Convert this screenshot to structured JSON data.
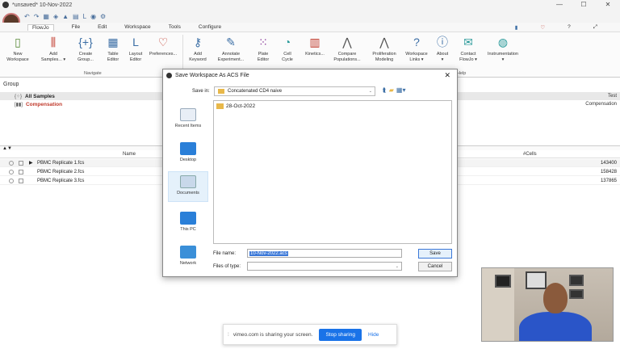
{
  "window": {
    "title": "*unsaved* 10-Nov-2022",
    "controls": [
      "—",
      "☐",
      "✕"
    ]
  },
  "tabs": [
    "FlowJo",
    "File",
    "Edit",
    "Workspace",
    "Tools",
    "Configure"
  ],
  "ribbon": {
    "buttons": [
      {
        "label": "New\nWorkspace",
        "icon": "new-doc-icon"
      },
      {
        "label": "Add\nSamples... ▾",
        "icon": "add-samples-icon"
      },
      {
        "label": "Create\nGroup...",
        "icon": "group-icon"
      },
      {
        "label": "Table\nEditor",
        "icon": "table-icon"
      },
      {
        "label": "Layout\nEditor",
        "icon": "layout-icon"
      },
      {
        "label": "Preferences...",
        "icon": "heart-icon"
      },
      {
        "label": "Add\nKeyword",
        "icon": "key-icon"
      },
      {
        "label": "Annotate\nExperiment...",
        "icon": "pen-icon"
      },
      {
        "label": "Plate\nEditor",
        "icon": "plate-icon"
      },
      {
        "label": "Cell\nCycle",
        "icon": "cell-cycle-icon"
      },
      {
        "label": "Kinetics...",
        "icon": "kinetics-icon"
      },
      {
        "label": "Compare\nPopulations...",
        "icon": "compare-icon"
      },
      {
        "label": "Proliferation\nModeling",
        "icon": "proliferation-icon"
      },
      {
        "label": "Workspace\nLinks ▾",
        "icon": "question-icon"
      },
      {
        "label": "About\n▾",
        "icon": "info-icon"
      },
      {
        "label": "Contact\nFlowJo ▾",
        "icon": "contact-icon"
      },
      {
        "label": "Instrumentation\n▾",
        "icon": "gauge-icon"
      }
    ],
    "group_navigate": "Navigate",
    "group_help": "Help"
  },
  "group_pane": {
    "header": "Group",
    "rows": [
      {
        "name": "All Samples",
        "right": "Test"
      },
      {
        "name": "Compensation",
        "right": "Compensation"
      }
    ]
  },
  "samples": {
    "col_name": "Name",
    "col_cells": "#Cells",
    "rows": [
      {
        "name": "PBMC Replicate 1.fcs",
        "cells": "143400"
      },
      {
        "name": "PBMC Replicate 2.fcs",
        "cells": "158428"
      },
      {
        "name": "PBMC Replicate 3.fcs",
        "cells": "137865"
      }
    ]
  },
  "dialog": {
    "title": "Save Workspace As ACS File",
    "save_in_label": "Save in:",
    "save_in_value": "Concatenated CD4 naive",
    "places": [
      "Recent Items",
      "Desktop",
      "Documents",
      "This PC",
      "Network"
    ],
    "files": [
      "28-Oct-2022"
    ],
    "file_name_label": "File name:",
    "file_name_value": "10-Nov-2022.acs",
    "file_type_label": "Files of type:",
    "save_button": "Save",
    "cancel_button": "Cancel"
  },
  "sharing": {
    "text": "vimeo.com is sharing your screen.",
    "stop": "Stop sharing",
    "hide": "Hide"
  }
}
